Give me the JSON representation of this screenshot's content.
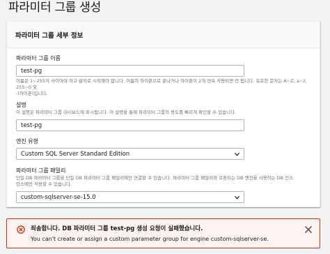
{
  "page": {
    "title": "파라미터 그룹 생성"
  },
  "panel": {
    "header": "파라미터 그룹 세부 정보"
  },
  "name_field": {
    "label": "파라미터 그룹 이름",
    "value": "test-pg",
    "hint_line1": "이름은 1~255자 사이여야 하고 글자로 시작해야 합니다. 이름이 하이픈으로 끝나거나 하이픈이 2개 연속 사용되면 안 됩니다. 유효한 문자는 A~Z, a~z, 255~0 및",
    "hint_line2": "-(하이픈)입니다."
  },
  "description_field": {
    "label": "설명",
    "hint": "이 설명은 파라미터 그룹 대시보드에 표시됩니다. 이 설명을 통해 파라미터 그룹의 용도를 빠르게 확인할 수 있습니다.",
    "value": "test-pg"
  },
  "engine_field": {
    "label": "엔진 유형",
    "value": "Custom SQL Server Standard Edition"
  },
  "family_field": {
    "label": "파라미터 그룹 패밀리",
    "hint_line1": "단일 DB 파라미터 그룹을 단일 DB 파라미터 그룹 패밀리에만 연결할 수 있습니다. 파라미터 그룹 패밀리와 호환되는 DB 엔진을 사용하는 DB 인스",
    "hint_line2": "턴스에만 적용할 수 있습니다.",
    "value": "custom-sqlserver-se-15.0"
  },
  "error": {
    "title": "죄송합니다. DB 파라미터 그룹 test-pg 생성 요청이 실패했습니다.",
    "message": "You can't create or assign a custom parameter group for engine custom-sqlserver-se."
  },
  "colors": {
    "error_border": "#d13212",
    "error_bg": "#fdf3f1",
    "input_border": "#aab7b8",
    "hint_text": "#687078"
  },
  "icons": {
    "error": "error-circle-x-icon",
    "close": "close-icon",
    "dropdown": "chevron-down-icon"
  }
}
